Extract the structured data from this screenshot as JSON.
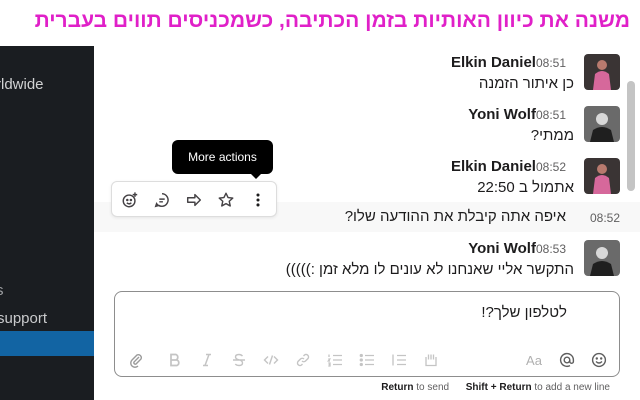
{
  "banner": {
    "text": "משנה את כיוון האותיות בזמן הכתיבה, כשמכניסים תווים בעברית"
  },
  "sidebar": {
    "workspace_fragment": "rldwide",
    "item_fragment": "s",
    "support_fragment": "support"
  },
  "messages": [
    {
      "name": "Elkin Daniel",
      "time": "08:51",
      "text": "כן איתור הזמנה"
    },
    {
      "name": "Yoni Wolf",
      "time": "08:51",
      "text": "ממתי?"
    },
    {
      "name": "Elkin Daniel",
      "time": "08:52",
      "text": "אתמול ב 22:50"
    },
    {
      "name": "Yoni Wolf",
      "time": "08:53",
      "text": "התקשר אליי שאנחנו לא עונים לו מלא זמן :)))))"
    }
  ],
  "hover_message": {
    "time": "08:52",
    "text": "איפה אתה קיבלת את ההודעה שלו?"
  },
  "message_actions": {
    "tooltip": "More actions",
    "icons": [
      "add-reaction-icon",
      "reply-in-thread-icon",
      "share-message-icon",
      "save-star-icon",
      "more-actions-icon"
    ]
  },
  "composer": {
    "value": "לטלפון שלך?!",
    "aa_label": "Aa",
    "hint_return_key": "Return",
    "hint_return_action": "to send",
    "hint_shift_key": "Shift + Return",
    "hint_shift_action": "to add a new line"
  },
  "colors": {
    "banner_text": "#e020c8",
    "sidebar_bg": "#1a1d21",
    "sidebar_active": "#1264a3",
    "tooltip_bg": "#000000"
  }
}
